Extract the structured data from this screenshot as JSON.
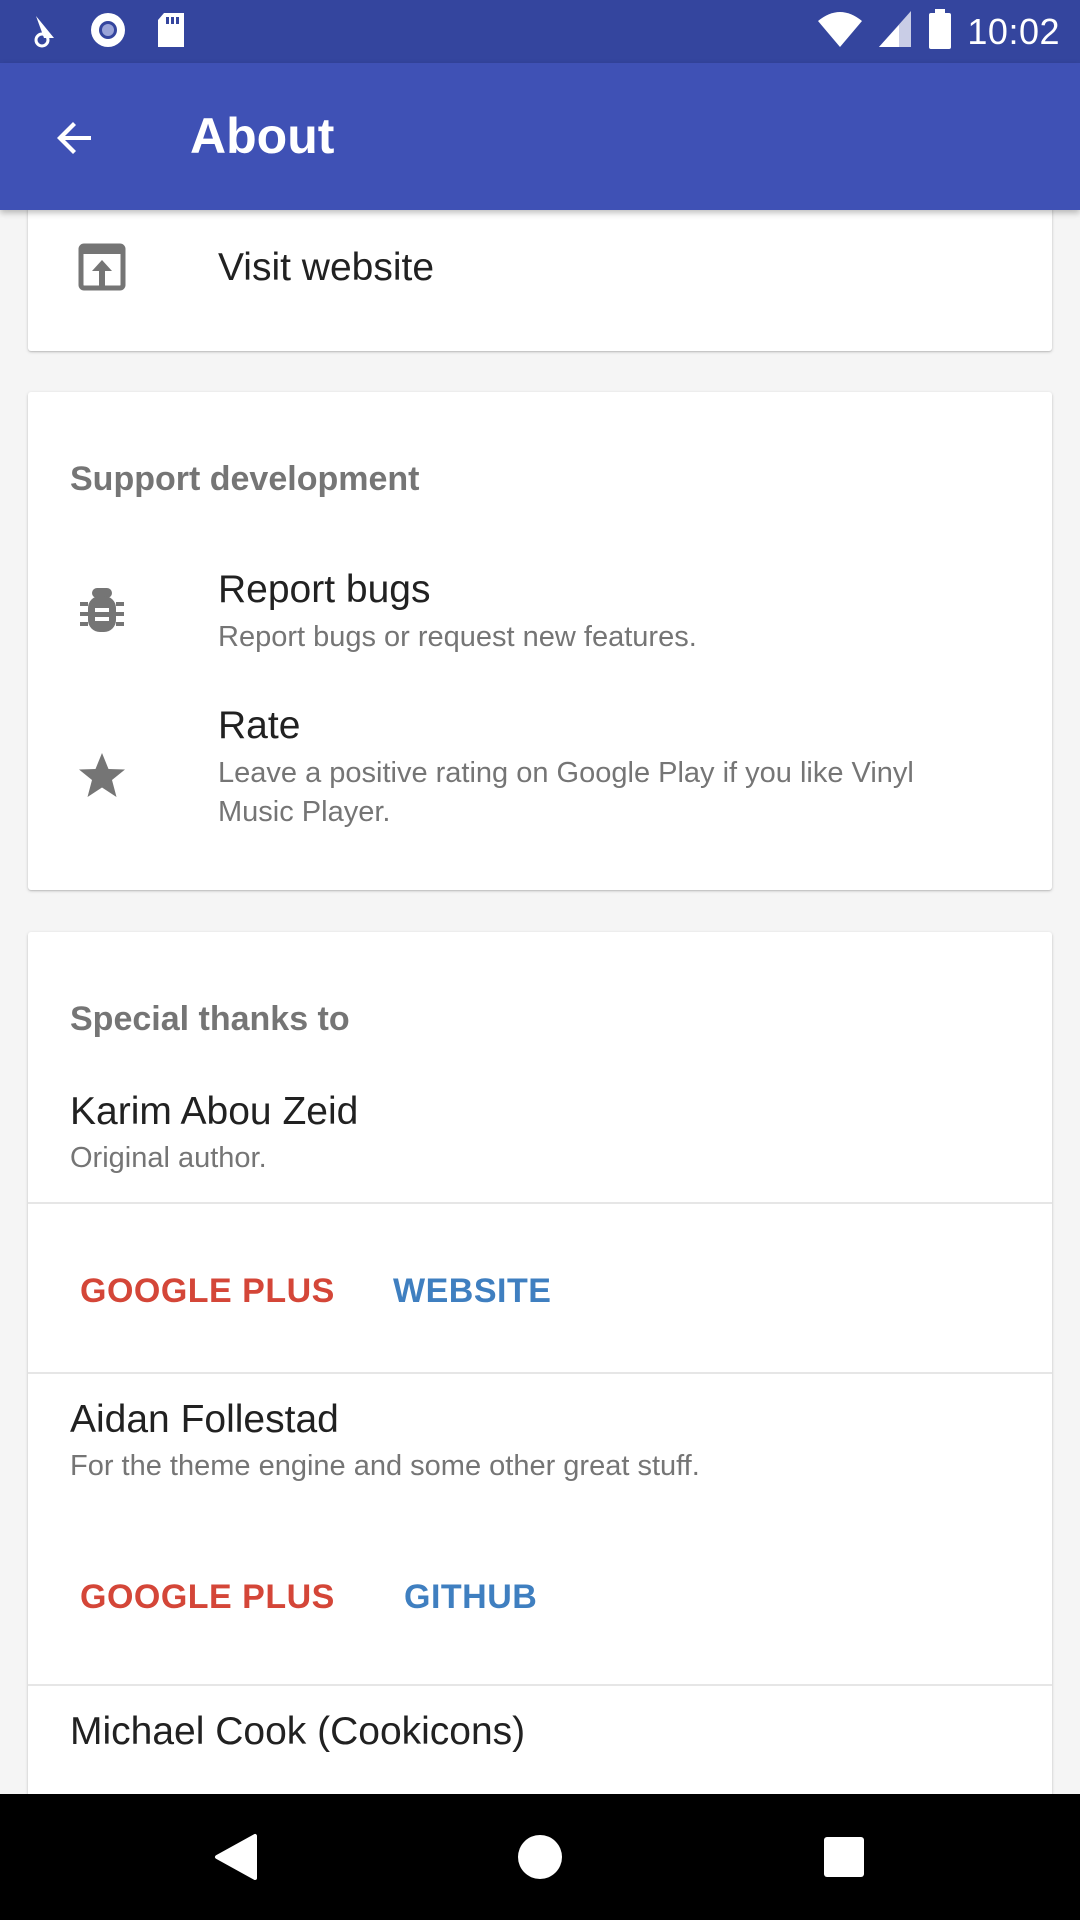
{
  "status_bar": {
    "time": "10:02",
    "left_icons": [
      "notification-icon",
      "circle-icon",
      "sd-card-icon"
    ],
    "right_icons": [
      "wifi-icon",
      "signal-icon",
      "battery-icon"
    ]
  },
  "app_bar": {
    "title": "About",
    "back_icon": "arrow-back-icon",
    "color": "#3f51b5"
  },
  "links_card": {
    "visit_website": {
      "label": "Visit website",
      "icon": "open-in-browser-icon"
    }
  },
  "support_card": {
    "heading": "Support development",
    "items": [
      {
        "title": "Report bugs",
        "subtitle": "Report bugs or request new features.",
        "icon": "bug-icon"
      },
      {
        "title": "Rate",
        "subtitle": "Leave a positive rating on Google Play if you like Vinyl Music Player.",
        "icon": "star-icon"
      }
    ]
  },
  "thanks_card": {
    "heading": "Special thanks to",
    "people": [
      {
        "name": "Karim Abou Zeid",
        "subtitle": "Original author.",
        "buttons": [
          "GOOGLE PLUS",
          "WEBSITE"
        ]
      },
      {
        "name": "Aidan Follestad",
        "subtitle": "For the theme engine and some other great stuff.",
        "buttons": [
          "GOOGLE PLUS",
          "GITHUB"
        ]
      },
      {
        "name": "Michael Cook (Cookicons)"
      }
    ]
  },
  "nav_bar": {
    "buttons": [
      "back-triangle-icon",
      "home-circle-icon",
      "recents-square-icon"
    ]
  }
}
